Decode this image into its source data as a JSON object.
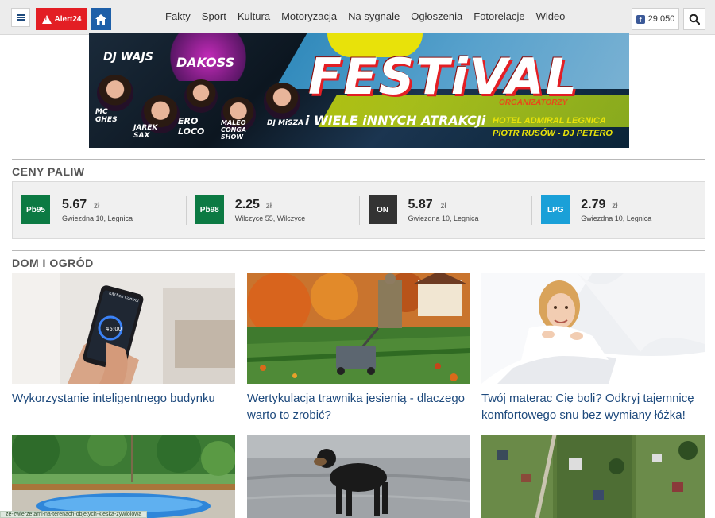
{
  "header": {
    "alert_label": "Alert24",
    "nav": [
      "Fakty",
      "Sport",
      "Kultura",
      "Motoryzacja",
      "Na sygnale",
      "Ogłoszenia",
      "Fotorelacje",
      "Wideo"
    ],
    "fb_count": "29 050",
    "icons": {
      "menu": "hamburger-icon",
      "home": "home-icon",
      "search": "search-icon",
      "facebook": "facebook-icon",
      "alert": "warning-icon"
    }
  },
  "banner": {
    "title": "FESTiVAL",
    "subtitle": "i WIELE iNNYCH ATRAKCJi",
    "organizers": "ORGANIZATORZY",
    "hotel": "HOTEL ADMIRAL LEGNICA",
    "hosts": "PIOTR RUSÓW - DJ PETERO",
    "djs": [
      "DJ WAJS",
      "DAKOSS",
      "MC GHES",
      "JAREK SAX",
      "ERO LOCO",
      "MALEO CONGA SHOW",
      "DJ MiSZA"
    ]
  },
  "fuel": {
    "title": "CENY PALIW",
    "items": [
      {
        "type": "Pb95",
        "price": "5.67",
        "unit": "zł",
        "location": "Gwiezdna 10, Legnica",
        "color": "#0c7a43"
      },
      {
        "type": "Pb98",
        "price": "2.25",
        "unit": "zł",
        "location": "Wilczyce 55, Wilczyce",
        "color": "#0c7a43"
      },
      {
        "type": "ON",
        "price": "5.87",
        "unit": "zł",
        "location": "Gwiezdna 10, Legnica",
        "color": "#333333"
      },
      {
        "type": "LPG",
        "price": "2.79",
        "unit": "zł",
        "location": "Gwiezdna 10, Legnica",
        "color": "#1aa0d8"
      }
    ]
  },
  "home_garden": {
    "title": "DOM I OGRÓD",
    "articles": [
      {
        "title": "Wykorzystanie inteligentnego budynku"
      },
      {
        "title": "Wertykulacja trawnika jesienią - dlaczego warto to zrobić?"
      },
      {
        "title": "Twój materac Cię boli? Odkryj tajemnicę komfortowego snu bez wymiany łóżka!"
      }
    ]
  },
  "phone_screen": {
    "app_title": "Kitchen Control",
    "value": "45:00"
  },
  "status_url": "ze-zwierzetami-na-terenach-objetych-kleska-zywiolowa"
}
